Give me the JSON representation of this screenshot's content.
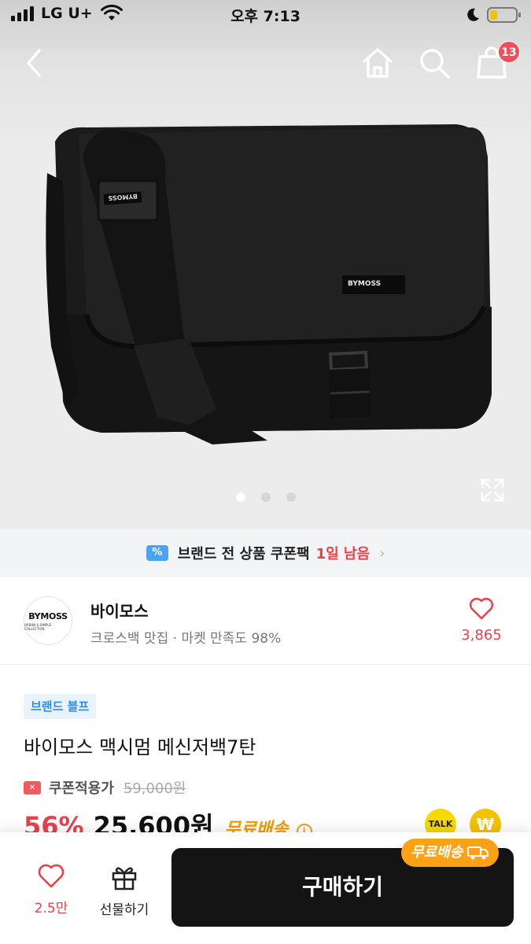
{
  "status_bar": {
    "carrier": "LG U+",
    "time": "오후 7:13"
  },
  "nav": {
    "cart_count": "13"
  },
  "hero": {
    "bag_label_front": "BYMOSS",
    "bag_label_strap": "BYMOSS",
    "page_count": 3,
    "active_page": 1
  },
  "coupon_banner": {
    "icon_text": "%",
    "text": "브랜드 전 상품 쿠폰팩",
    "remaining": "1일 남음",
    "chevron": "›"
  },
  "store": {
    "logo_text": "BYMOSS",
    "logo_sub": "URBAN & SIMPLE COLLECTION",
    "name": "바이모스",
    "subtitle": "크로스백 맛집 · 마켓 만족도 98%",
    "like_count": "3,865"
  },
  "product": {
    "tag": "브랜드 블프",
    "title": "바이모스 맥시멈 메신저백7탄",
    "coupon_label": "쿠폰적용가",
    "original_price": "59,000원",
    "discount": "56%",
    "price": "25,600원",
    "shipping": "무료배송",
    "info_icon": "i",
    "talk_label": "TALK",
    "won_symbol": "₩"
  },
  "bottom_bar": {
    "wish_count": "2.5만",
    "gift_label": "선물하기",
    "buy_label": "구매하기",
    "shipping_badge": "무료배송"
  },
  "colors": {
    "accent_red": "#e9414b",
    "coupon_blue": "#4aa4f5",
    "shipping_orange": "#ffa115",
    "buy_button": "#141414"
  }
}
